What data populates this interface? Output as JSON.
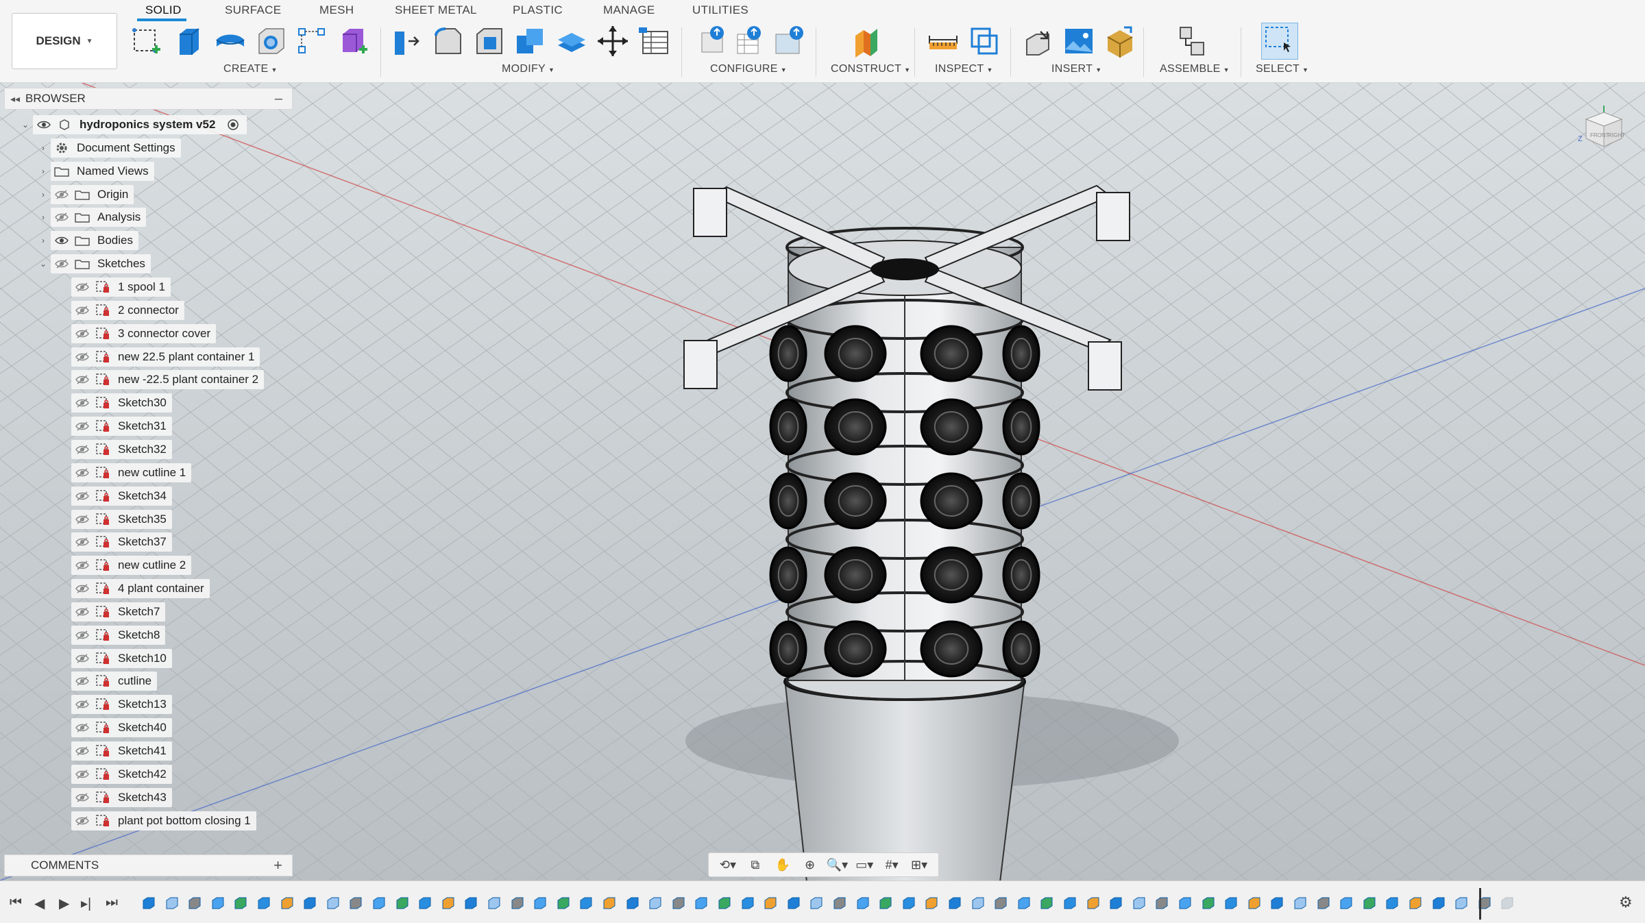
{
  "workspace": {
    "label": "DESIGN"
  },
  "tabs": [
    "SOLID",
    "SURFACE",
    "MESH",
    "SHEET METAL",
    "PLASTIC",
    "MANAGE",
    "UTILITIES"
  ],
  "groups": {
    "create": "CREATE",
    "modify": "MODIFY",
    "configure": "CONFIGURE",
    "construct": "CONSTRUCT",
    "inspect": "INSPECT",
    "insert": "INSERT",
    "assemble": "ASSEMBLE",
    "select": "SELECT"
  },
  "browser": {
    "title": "BROWSER",
    "root": "hydroponics system v52",
    "top_items": [
      "Document Settings",
      "Named Views",
      "Origin",
      "Analysis",
      "Bodies",
      "Sketches"
    ],
    "sketches": [
      "1 spool 1",
      "2 connector",
      "3 connector cover",
      "new 22.5 plant container 1",
      "new -22.5 plant container 2",
      "Sketch30",
      "Sketch31",
      "Sketch32",
      "new cutline 1",
      "Sketch34",
      "Sketch35",
      "Sketch37",
      "new cutline 2",
      "4 plant container",
      "Sketch7",
      "Sketch8",
      "Sketch10",
      "cutline",
      "Sketch13",
      "Sketch40",
      "Sketch41",
      "Sketch42",
      "Sketch43",
      "plant pot bottom closing 1"
    ]
  },
  "comments": {
    "title": "COMMENTS"
  },
  "viewcube": {
    "front": "FRONT",
    "right": "RIGHT",
    "axis_z": "Z"
  },
  "colors": {
    "accent": "#1a8ad4",
    "viewport_bg": "#c9ced2"
  }
}
